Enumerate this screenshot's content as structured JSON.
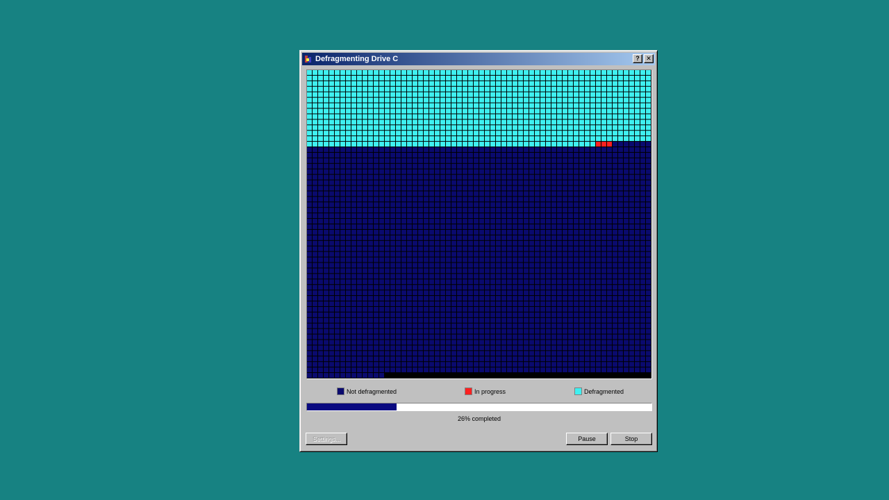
{
  "window": {
    "title": "Defragmenting Drive C",
    "help_button": "?",
    "close_button": "✕"
  },
  "cluster_map": {
    "columns": 62,
    "rows": 56,
    "defragmented_rows": 14,
    "in_progress_row": 13,
    "in_progress_start_col": 52,
    "in_progress_count": 3,
    "unused_last_row_from_col": 14,
    "colors": {
      "not_defragmented": "#0a0a6e",
      "in_progress": "#ff2020",
      "defragmented": "#3ff0f0",
      "grid": "#000000"
    }
  },
  "legend": {
    "not_defragmented": "Not defragmented",
    "in_progress": "In progress",
    "defragmented": "Defragmented"
  },
  "progress": {
    "percent": 26,
    "label": "26% completed"
  },
  "buttons": {
    "settings": "Settings...",
    "pause": "Pause",
    "stop": "Stop"
  }
}
